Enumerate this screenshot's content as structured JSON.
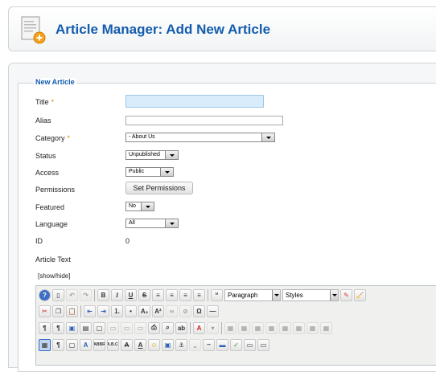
{
  "header": {
    "title": "Article Manager: Add New Article",
    "icon": "add-article-icon"
  },
  "form": {
    "legend": "New Article",
    "fields": {
      "title": {
        "label": "Title",
        "required_mark": "*",
        "value": ""
      },
      "alias": {
        "label": "Alias",
        "value": ""
      },
      "category": {
        "label": "Category",
        "required_mark": "*",
        "value": "- About Us"
      },
      "status": {
        "label": "Status",
        "value": "Unpublished"
      },
      "access": {
        "label": "Access",
        "value": "Public"
      },
      "permissions": {
        "label": "Permissions",
        "button": "Set Permissions"
      },
      "featured": {
        "label": "Featured",
        "value": "No"
      },
      "language": {
        "label": "Language",
        "value": "All"
      },
      "id": {
        "label": "ID",
        "value": "0"
      },
      "article_text": {
        "label": "Article Text"
      }
    },
    "show_hide": "[show/hide]"
  },
  "editor": {
    "format_select": "Paragraph",
    "styles_select": "Styles",
    "row1": [
      "help",
      "new-document",
      "undo",
      "redo",
      "bold",
      "italic",
      "underline",
      "strikethrough",
      "align-left",
      "align-center",
      "align-right",
      "justify",
      "blockquote"
    ],
    "row1_labels": {
      "bold": "B",
      "italic": "I",
      "underline": "U",
      "strikethrough": "S",
      "blockquote": "“"
    },
    "row2_labels": {
      "subscript": "A₂",
      "superscript": "A²",
      "special-char": "Ω"
    },
    "row3_labels": {
      "ltr": "¶",
      "rtl": "¶",
      "find": "🔍",
      "replace": "ab"
    },
    "row4_labels": {
      "paragraph": "¶",
      "styles": "A",
      "abbr": "ABBR",
      "acronym": "A.B.C.",
      "del": "A",
      "ins": "A"
    }
  }
}
